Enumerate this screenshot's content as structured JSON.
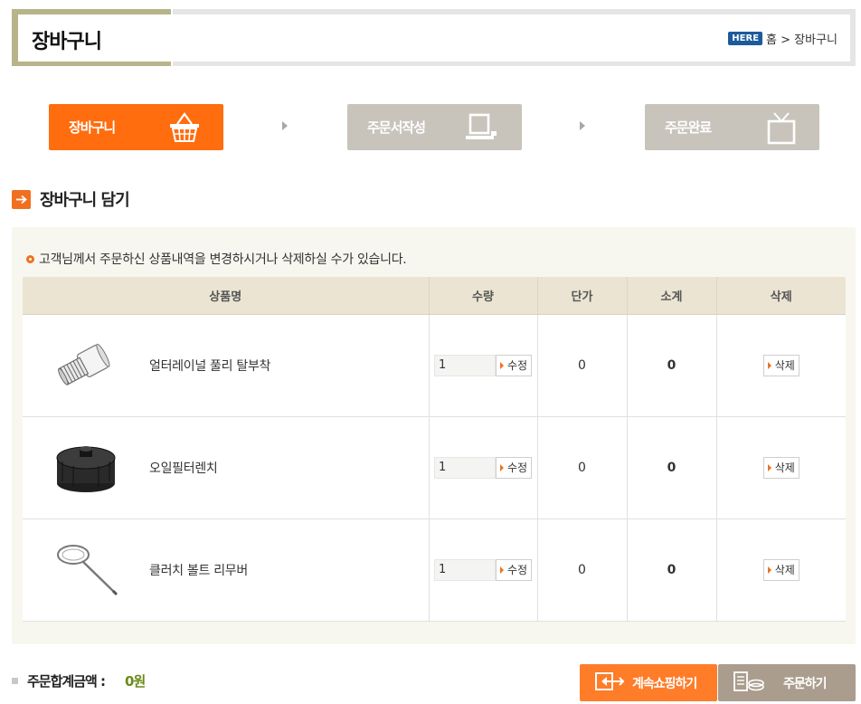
{
  "header": {
    "title": "장바구니",
    "here_badge": "HERE",
    "breadcrumb": "홈 > 장바구니"
  },
  "steps": [
    {
      "label": "장바구니",
      "icon": "basket-icon",
      "active": true
    },
    {
      "label": "주문서작성",
      "icon": "printer-icon",
      "active": false
    },
    {
      "label": "주문완료",
      "icon": "tv-icon",
      "active": false
    }
  ],
  "section": {
    "title": "장바구니 담기",
    "notice": "고객님께서 주문하신 상품내역을 변경하시거나 삭제하실 수가 있습니다."
  },
  "table": {
    "headers": [
      "상품명",
      "수량",
      "단가",
      "소계",
      "삭제"
    ],
    "rows": [
      {
        "name": "얼터레이널 풀리 탈부착",
        "qty": "1",
        "update_label": "수정",
        "price": "0",
        "subtotal": "0",
        "delete_label": "삭제"
      },
      {
        "name": "오일필터렌치",
        "qty": "1",
        "update_label": "수정",
        "price": "0",
        "subtotal": "0",
        "delete_label": "삭제"
      },
      {
        "name": "클러치 볼트 리무버",
        "qty": "1",
        "update_label": "수정",
        "price": "0",
        "subtotal": "0",
        "delete_label": "삭제"
      }
    ]
  },
  "footer": {
    "total_label": "주문합계금액 :",
    "total_value": "0원",
    "continue_label": "계속쇼핑하기",
    "order_label": "주문하기"
  },
  "colors": {
    "accent": "#ff6d0f",
    "inactive_step": "#c8c4bc",
    "subtotal": "#6a8b18",
    "header_band": "#b8b48a"
  }
}
